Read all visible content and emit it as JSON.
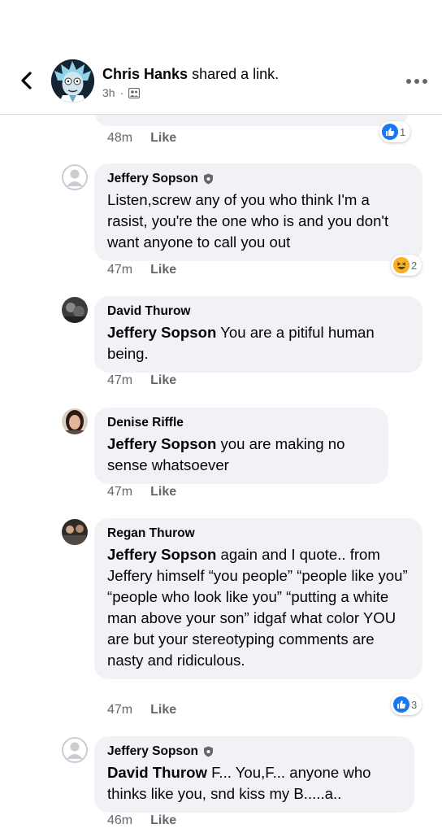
{
  "header": {
    "author": "Chris Hanks",
    "action": "shared a link.",
    "time": "3h",
    "dot": "·"
  },
  "comments": [
    {
      "time": "48m",
      "like_label": "Like",
      "reaction": {
        "type": "like",
        "count": "1"
      }
    },
    {
      "name": "Jeffery Sopson",
      "text": "Listen,screw any of you who think I'm a rasist, you're the one who is and you don't want anyone to call you out",
      "time": "47m",
      "like_label": "Like",
      "reaction": {
        "type": "haha",
        "count": "2"
      }
    },
    {
      "name": "David Thurow",
      "mention": "Jeffery Sopson",
      "text": " You are a pitiful human being.",
      "time": "47m",
      "like_label": "Like"
    },
    {
      "name": "Denise Riffle",
      "mention": "Jeffery Sopson",
      "text": " you are making no sense whatsoever",
      "time": "47m",
      "like_label": "Like"
    },
    {
      "name": "Regan Thurow",
      "mention": "Jeffery Sopson",
      "text": " again and I quote.. from Jeffery himself “you people” “people like you” “people who look like you” “putting a white man above your son” idgaf what color YOU are but your stereotyping comments are nasty and ridiculous.",
      "time": "47m",
      "like_label": "Like",
      "reaction": {
        "type": "like",
        "count": "3"
      }
    },
    {
      "name": "Jeffery Sopson",
      "mention": "David Thurow",
      "text": " F... You,F... anyone who thinks like you, snd kiss my B.....a..",
      "time": "46m",
      "like_label": "Like"
    }
  ],
  "colors": {
    "like_blue": "#1877f2",
    "bubble_bg": "#f0f2f5",
    "meta_gray": "#65676b"
  }
}
